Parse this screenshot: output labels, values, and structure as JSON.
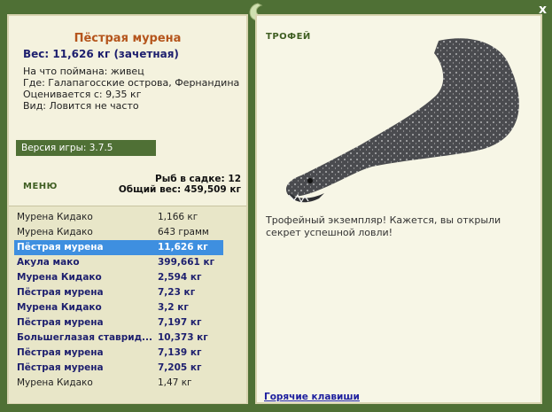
{
  "fish": {
    "title": "Пёстрая мурена",
    "weight": "Вес: 11,626 кг (зачетная)",
    "bait": "На что поймана: живец",
    "location": "Где: Галапагосские острова, Фернандина",
    "estimate": "Оценивается с: 9,35 кг",
    "kind": "Вид: Ловится не часто"
  },
  "version": "Версия игры: 3.7.5",
  "menu_label": "МЕНЮ",
  "keep": {
    "count": "Рыб в садке: 12",
    "total": "Общий вес: 459,509 кг"
  },
  "catch_list": [
    {
      "name": "Мурена Кидако",
      "weight": "1,166 кг",
      "style": "plain"
    },
    {
      "name": "Мурена Кидако",
      "weight": "643 грамм",
      "style": "plain"
    },
    {
      "name": "Пёстрая мурена",
      "weight": "11,626 кг",
      "style": "sel"
    },
    {
      "name": "Акула мако",
      "weight": "399,661 кг",
      "style": "bold"
    },
    {
      "name": "Мурена Кидако",
      "weight": "2,594 кг",
      "style": "bold"
    },
    {
      "name": "Пёстрая мурена",
      "weight": "7,23 кг",
      "style": "bold"
    },
    {
      "name": "Мурена Кидако",
      "weight": "3,2 кг",
      "style": "bold"
    },
    {
      "name": "Пёстрая мурена",
      "weight": "7,197 кг",
      "style": "bold"
    },
    {
      "name": "Большеглазая ставрид...",
      "weight": "10,373 кг",
      "style": "bold"
    },
    {
      "name": "Пёстрая мурена",
      "weight": "7,139 кг",
      "style": "bold"
    },
    {
      "name": "Пёстрая мурена",
      "weight": "7,205 кг",
      "style": "bold"
    },
    {
      "name": "Мурена Кидако",
      "weight": "1,47 кг",
      "style": "plain"
    }
  ],
  "trophy": {
    "label": "ТРОФЕЙ",
    "text": "Трофейный экземпляр! Кажется, вы открыли секрет успешной ловли!"
  },
  "hotkeys": "Горячие клавиши",
  "close": "x",
  "icons": {
    "logo": "fish-hook-logo-icon",
    "close": "close-icon"
  }
}
